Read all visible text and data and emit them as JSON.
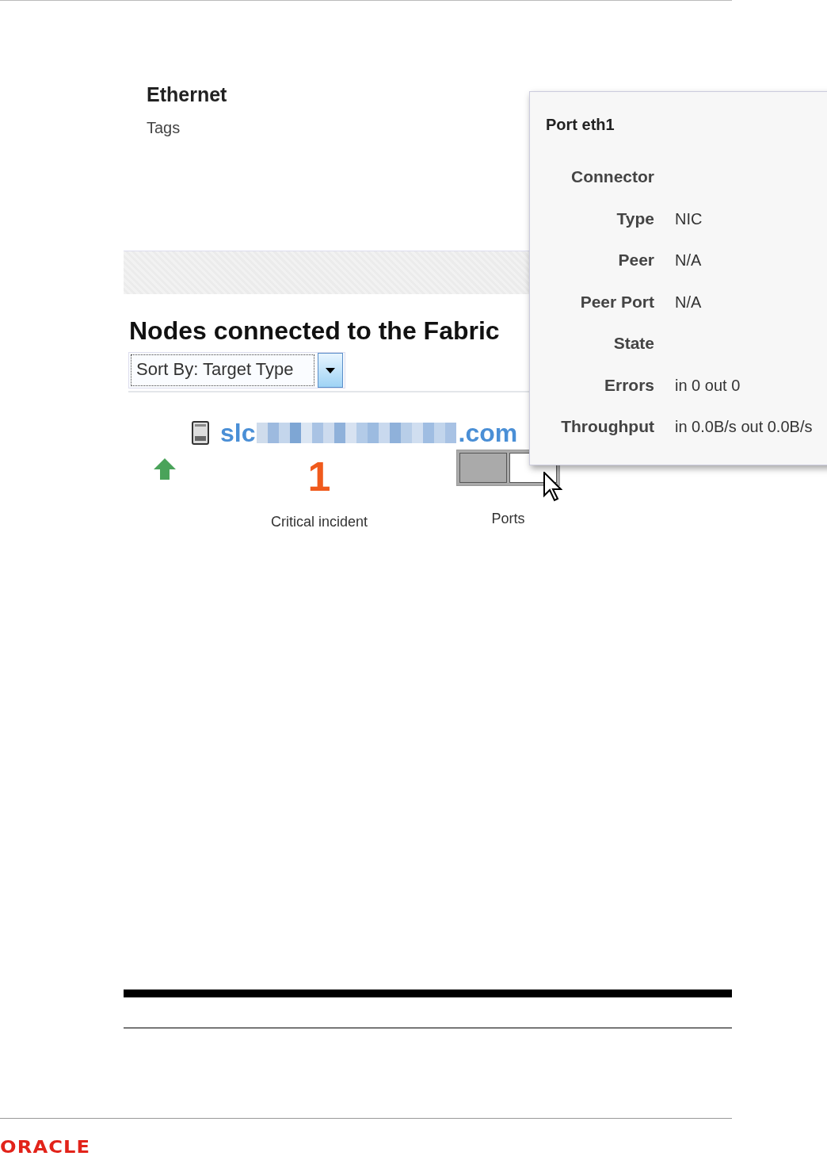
{
  "section": {
    "title": "Ethernet",
    "tags_label": "Tags"
  },
  "nodes": {
    "title": "Nodes connected to the Fabric",
    "sort": {
      "value": "Sort By: Target Type"
    },
    "host": {
      "name_start": "slc",
      "name_end": ".com",
      "up": true
    },
    "incidents": {
      "count": "1",
      "label": "Critical incident"
    },
    "ports": {
      "label": "Ports",
      "items": [
        {
          "filled": true
        },
        {
          "filled": false
        }
      ]
    }
  },
  "popup": {
    "title": "Port eth1",
    "rows": [
      {
        "label": "Connector"
      },
      {
        "label": "Type",
        "value": "NIC"
      },
      {
        "label": "Peer",
        "value": "N/A"
      },
      {
        "label": "Peer Port",
        "value": "N/A"
      },
      {
        "label": "State"
      },
      {
        "label": "Errors",
        "value": "in 0 out 0"
      },
      {
        "label": "Throughput",
        "value": "in 0.0B/s out 0.0B/s"
      }
    ]
  },
  "footer": {
    "logo": "ORACLE"
  }
}
